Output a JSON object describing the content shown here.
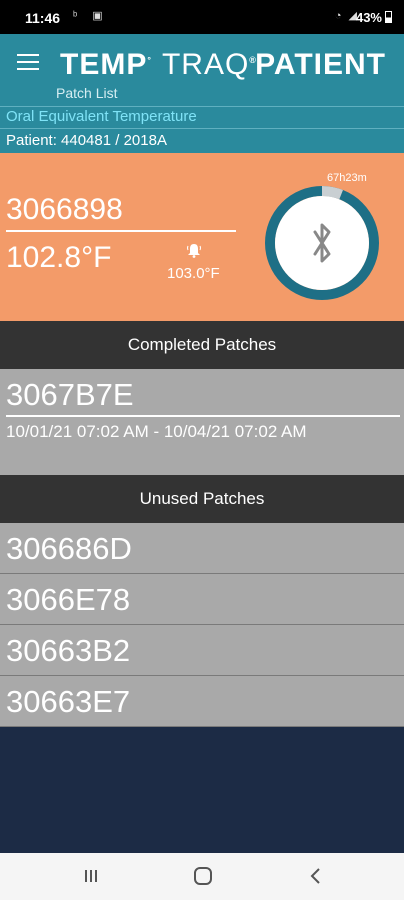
{
  "status_bar": {
    "time": "11:46",
    "left_icons": "ᵇ ▣",
    "right_icons": "◔ ◢",
    "battery": "43%"
  },
  "header": {
    "brand_part1": "TEMP",
    "brand_part2": "TRAQ",
    "role": "PATIENT",
    "subtitle": "Patch List"
  },
  "info": {
    "mode": "Oral Equivalent Temperature",
    "patient": "Patient: 440481 / 2018A"
  },
  "active_patch": {
    "id": "3066898",
    "temperature": "102.8°F",
    "alarm_threshold": "103.0°F",
    "timer": "67h23m",
    "progress_fraction": 0.94
  },
  "completed": {
    "header": "Completed Patches",
    "items": [
      {
        "id": "3067B7E",
        "range": "10/01/21 07:02 AM - 10/04/21 07:02 AM"
      }
    ]
  },
  "unused": {
    "header": "Unused Patches",
    "items": [
      "306686D",
      "3066E78",
      "30663B2",
      "30663E7"
    ]
  },
  "colors": {
    "teal": "#2a8a9d",
    "orange": "#f39b69",
    "ring": "#1e6f86",
    "gray": "#a9a9a9",
    "dark": "#333333",
    "navy": "#1c2b45"
  }
}
